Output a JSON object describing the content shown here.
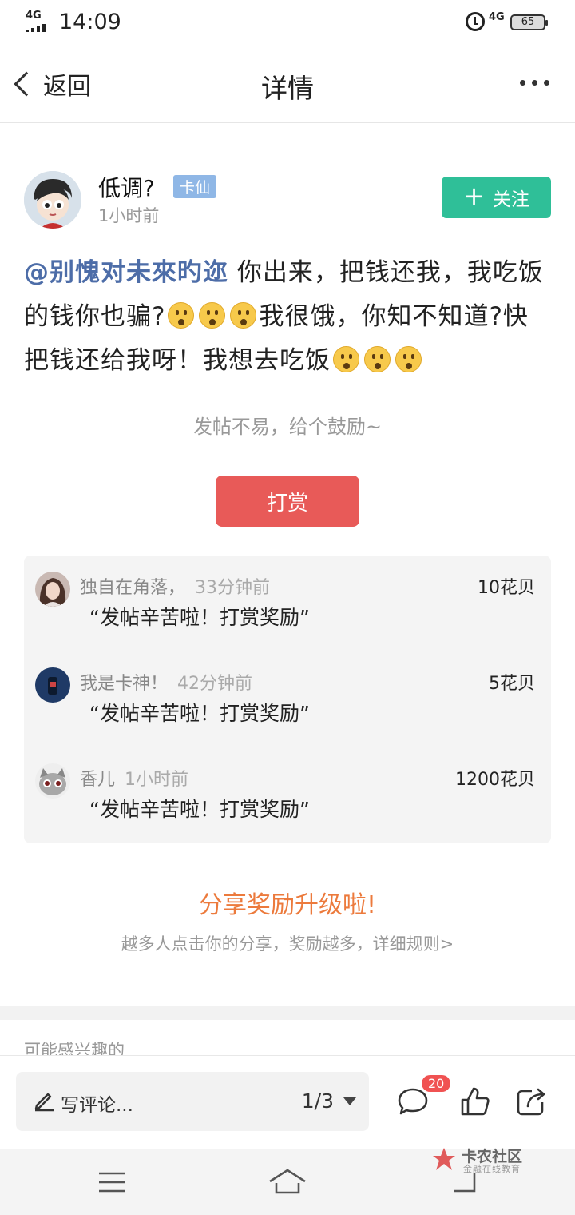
{
  "status_bar": {
    "network": "4G",
    "time": "14:09",
    "network_right": "4G",
    "battery": "65"
  },
  "navbar": {
    "back_label": "返回",
    "title": "详情"
  },
  "author": {
    "name": "低调?",
    "badge": "卡仙",
    "time": "1小时前",
    "follow_label": "关注"
  },
  "post": {
    "mention": "@别愧对未來旳迩",
    "text_1": " 你出来，把钱还我，我吃饭的钱你也骗?",
    "text_2": "我很饿，你知不知道?快把钱还给我呀！我想去吃饭"
  },
  "encourage_text": "发帖不易，给个鼓励~",
  "tip_button": "打赏",
  "rewards": [
    {
      "name": "独自在角落，",
      "time": "33分钟前",
      "amount": "10花贝",
      "message": "“发帖辛苦啦！打赏奖励”"
    },
    {
      "name": "我是卡神！",
      "time": "42分钟前",
      "amount": "5花贝",
      "message": "“发帖辛苦啦！打赏奖励”"
    },
    {
      "name": "香儿",
      "time": "1小时前",
      "amount": "1200花贝",
      "message": "“发帖辛苦啦！打赏奖励”"
    }
  ],
  "share": {
    "title": "分享奖励升级啦!",
    "subtitle": "越多人点击你的分享，奖励越多，详细规则>"
  },
  "interest_label": "可能感兴趣的",
  "bottom_bar": {
    "comment_placeholder": "写评论...",
    "page_indicator": "1/3",
    "comment_count": "20"
  },
  "watermark": {
    "main": "卡农社区",
    "sub": "金融在线教育"
  },
  "colors": {
    "follow": "#2fbf98",
    "tip": "#e85a58",
    "mention": "#4d6da8",
    "share_title": "#ec7a3c",
    "badge": "#f05252"
  }
}
